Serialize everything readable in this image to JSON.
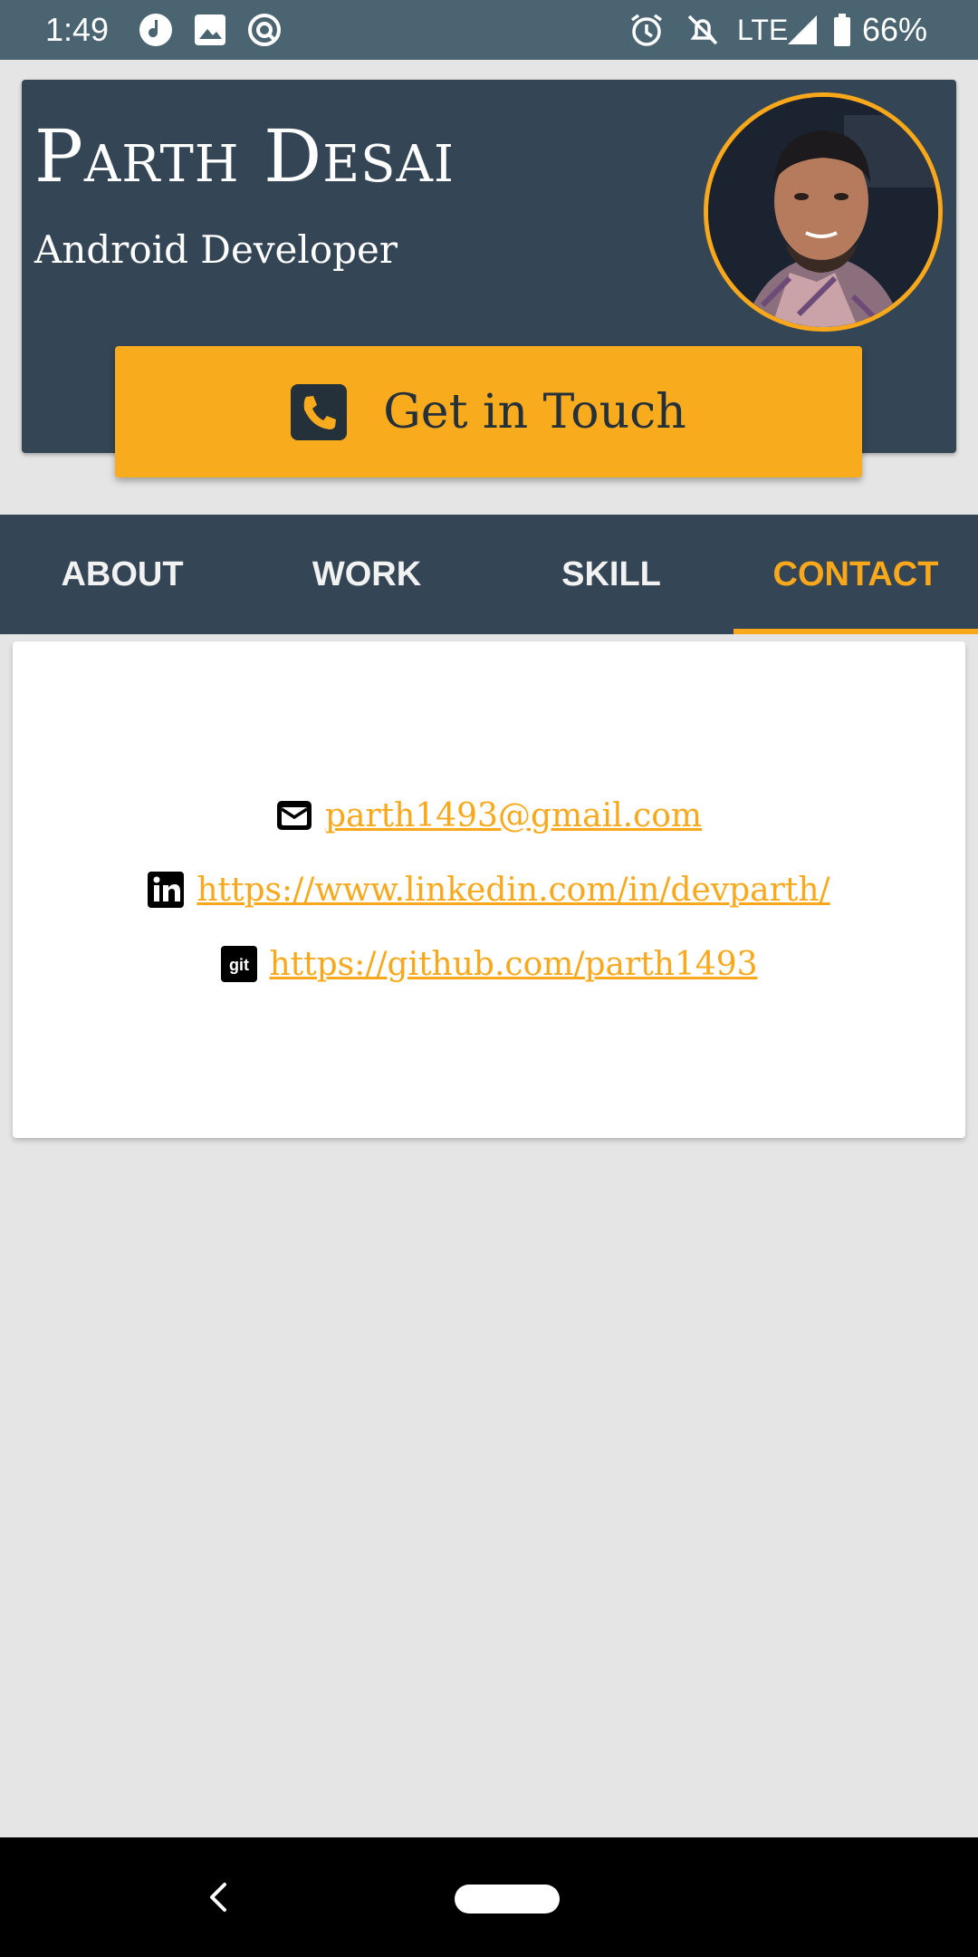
{
  "status_bar": {
    "time": "1:49",
    "network": "LTE",
    "battery": "66%"
  },
  "profile": {
    "name": "Parth Desai",
    "role": "Android Developer",
    "cta_label": "Get in Touch"
  },
  "tabs": [
    {
      "label": "ABOUT"
    },
    {
      "label": "WORK"
    },
    {
      "label": "SKILL"
    },
    {
      "label": "CONTACT"
    }
  ],
  "active_tab": "CONTACT",
  "contact": {
    "email": "parth1493@gmail.com",
    "linkedin": "https://www.linkedin.com/in/devparth/",
    "github": "https://github.com/parth1493",
    "github_icon_text": "git"
  },
  "colors": {
    "accent": "#f9a81b",
    "header_bg": "#344655",
    "status_bar_bg": "#4b6471",
    "page_bg": "#e5e5e5"
  },
  "icons": {
    "cta": "phone-icon",
    "email": "envelope-icon",
    "linkedin": "linkedin-icon",
    "github": "git-icon"
  }
}
